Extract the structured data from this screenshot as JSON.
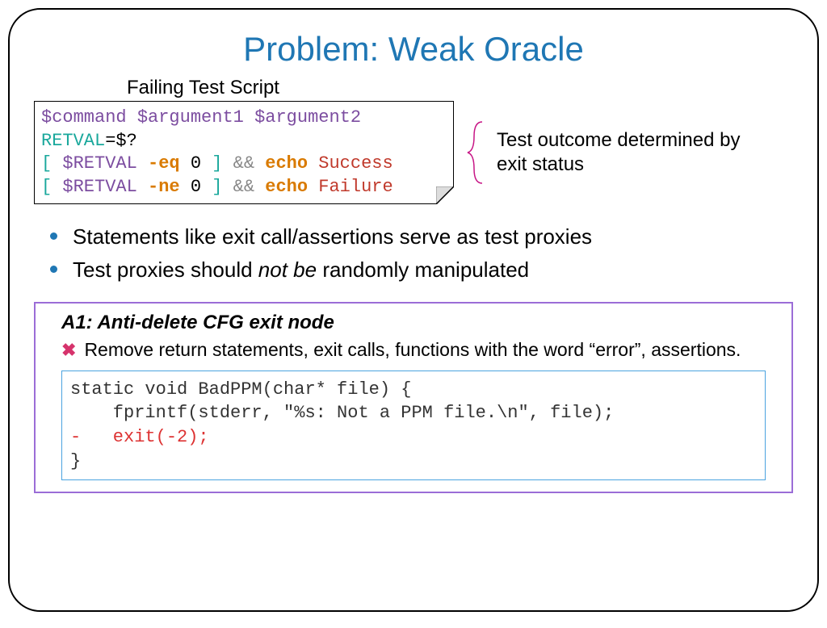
{
  "title": "Problem: Weak Oracle",
  "subheading": "Failing Test Script",
  "script": {
    "line1": {
      "t1": "$command",
      "t2": "$argument1",
      "t3": "$argument2"
    },
    "line2": {
      "t1": "RETVAL",
      "t2": "=",
      "t3": "$?"
    },
    "line3": {
      "lb": "[ ",
      "var": "$RETVAL",
      "op": " -eq ",
      "zero": "0",
      "rb": " ]",
      "amp": " && ",
      "echo": "echo",
      "res": " Success"
    },
    "line4": {
      "lb": "[ ",
      "var": "$RETVAL",
      "op": " -ne ",
      "zero": "0",
      "rb": " ]",
      "amp": " && ",
      "echo": "echo",
      "res": " Failure"
    }
  },
  "annotation": "Test outcome determined by exit status",
  "bullets": {
    "b1": "Statements like exit call/assertions serve as test proxies",
    "b2_pre": "Test proxies should ",
    "b2_it": "not be",
    "b2_post": " randomly manipulated"
  },
  "a1": {
    "title": "A1: Anti-delete CFG exit node",
    "x_text": "Remove return statements, exit calls, functions with the word “error”, assertions.",
    "code": {
      "l1": "static void BadPPM(char* file) {",
      "l2": "    fprintf(stderr, \"%s: Not a PPM file.\\n\", file);",
      "l3": "-   exit(-2);",
      "l4": "}"
    }
  }
}
